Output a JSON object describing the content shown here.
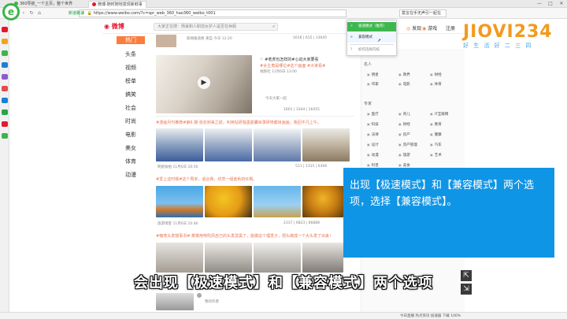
{
  "browser": {
    "tabs": [
      {
        "label": "360导航_一个主页，整个世界",
        "color": "#3cb44a"
      },
      {
        "label": "微博-随时随地发现新鲜事",
        "color": "#e6162d"
      }
    ],
    "address": "https://www.weibo.com/?c=spr_web_360_hao360_weibo_t001",
    "address_mode_label": "新道路速",
    "search_box": "莫言在手无声引一起在",
    "window_controls": {
      "min": "—",
      "max": "□",
      "close": "✕"
    }
  },
  "weibo": {
    "logo": "微博",
    "search_placeholder": "大家正在搜：杨幂和人职前女护人是否在休假",
    "header_links": {
      "home": "首页",
      "discover": "发现",
      "game": "游戏",
      "register": "注册"
    },
    "nav": [
      "热门",
      "头条",
      "视频",
      "榜单",
      "搞笑",
      "社会",
      "时尚",
      "电影",
      "美女",
      "体育",
      "动漫"
    ],
    "posts": [
      {
        "author": "新闻报道君",
        "meta": "来自 今天 12:20",
        "actions": "1616  |  615  |  13045"
      },
      {
        "caption": "#女主角是哪位#这个画面 #大家看#",
        "author": "视频社",
        "meta": "11月6日 13:00",
        "actions": "1601  |  3344  |  16455",
        "text1": "♡ #老虎也怎样的#心动大家要看",
        "text2": "今天大家一起"
      },
      {
        "text": "#漫画月刊推荐#第6 期 张兆到来之前，利用钻研独墨胶囊目录研修都目画画，我回不凡上午。",
        "author": "明星偷拍",
        "meta": "11月6日 20:50",
        "actions": "511  |  1315  |  6306"
      },
      {
        "text": "#爱上这时候#这个周末，适合我，欣赏一组金秋的红枫。",
        "author": "旅游博客",
        "meta": "11月6日 10:46",
        "actions": "2337  |  6823  |  66888"
      },
      {
        "text": "#萌宠头发镜事书# 菜菜用电吹风自己的头发烫黑了，能做这个理发子，把头做成一个大头发了出来！",
        "author": "",
        "meta": "",
        "actions": ""
      },
      {
        "author": "我的作者",
        "meta": "",
        "actions": ""
      }
    ],
    "right": {
      "famous_header": "名人",
      "famous_items": [
        "明星",
        "政界",
        "财经",
        "作家",
        "电影",
        "体育"
      ],
      "expert_header": "专家",
      "expert_items": [
        "医疗",
        "育儿",
        "IT互联网",
        "科技",
        "财经",
        "教育",
        "法律",
        "房产",
        "健康",
        "设计",
        "资产管理",
        "汽车",
        "动漫",
        "旅游",
        "艺术",
        "科普",
        "美食"
      ]
    }
  },
  "dropdown": {
    "items": [
      "极速模式（推荐）",
      "兼容模式",
      "如何选择内核"
    ]
  },
  "brand": {
    "main": "JIOVI234",
    "sub": "好 生 活 好 二 三 四"
  },
  "callout": {
    "text": "出现【极速模式】和【兼容模式】两个选项，选择【兼容模式】。"
  },
  "subtitle": "会出现【极速模式】和【兼容模式】两个选项",
  "statusbar": {
    "zoom": "100%",
    "items": "今日直播  热点资讯  加速器  下载  100%"
  },
  "colors": {
    "accent": "#3eb84e",
    "weibo_orange": "#fa7d3c",
    "callout_blue": "#0f95e6"
  }
}
